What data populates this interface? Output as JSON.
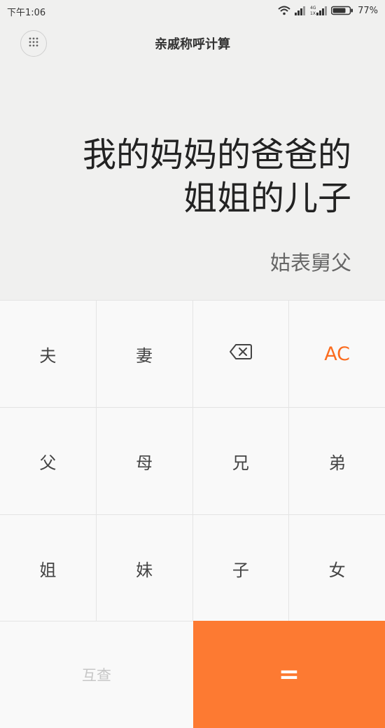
{
  "status_bar": {
    "time": "下午1:06",
    "battery_percent": "77%",
    "icons": [
      "wifi-icon",
      "signal-icon",
      "signal-4g-icon",
      "battery-icon"
    ]
  },
  "header": {
    "title": "亲戚称呼计算",
    "menu_icon": "grid-dots-icon"
  },
  "display": {
    "expression_line1": "我的妈妈的爸爸的",
    "expression_line2": "姐姐的儿子",
    "result": "姑表舅父"
  },
  "keypad": {
    "row1": [
      "夫",
      "妻",
      "⌫",
      "AC"
    ],
    "row2": [
      "父",
      "母",
      "兄",
      "弟"
    ],
    "row3": [
      "姐",
      "妹",
      "子",
      "女"
    ],
    "mutual_label": "互查",
    "equals_label": "="
  },
  "colors": {
    "accent": "#fd7a32",
    "ac_text": "#fb6c1f",
    "display_bg": "#f0f0ef",
    "keypad_bg": "#f9f9f9"
  }
}
